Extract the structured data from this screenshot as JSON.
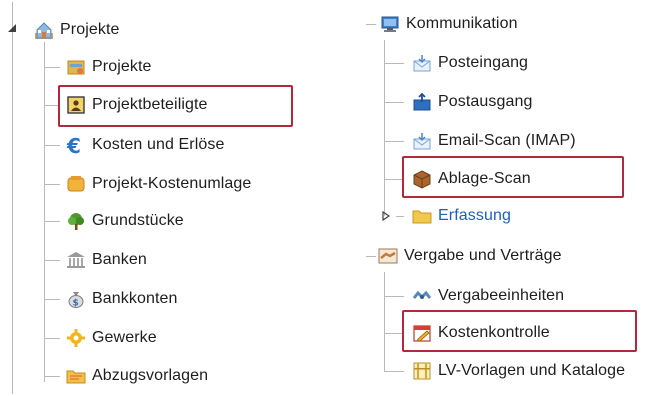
{
  "left_tree": {
    "root": {
      "label": "Projekte",
      "icon": "projects-house-icon",
      "expanded": true
    },
    "children": [
      {
        "label": "Projekte",
        "icon": "project-folder-icon"
      },
      {
        "label": "Projektbeteiligte",
        "icon": "contact-card-icon",
        "highlighted": true
      },
      {
        "label": "Kosten und Erlöse",
        "icon": "euro-icon"
      },
      {
        "label": "Projekt-Kostenumlage",
        "icon": "cost-allocation-icon"
      },
      {
        "label": "Grundstücke",
        "icon": "tree-icon"
      },
      {
        "label": "Banken",
        "icon": "bank-icon"
      },
      {
        "label": "Bankkonten",
        "icon": "money-bag-icon"
      },
      {
        "label": "Gewerke",
        "icon": "gear-icon"
      },
      {
        "label": "Abzugsvorlagen",
        "icon": "folder-template-icon"
      }
    ]
  },
  "right_tree": {
    "kommunikation": {
      "label": "Kommunikation",
      "icon": "network-computer-icon",
      "children": [
        {
          "label": "Posteingang",
          "icon": "inbox-icon"
        },
        {
          "label": "Postausgang",
          "icon": "outbox-icon"
        },
        {
          "label": "Email-Scan (IMAP)",
          "icon": "email-scan-icon"
        },
        {
          "label": "Ablage-Scan",
          "icon": "archive-box-icon",
          "highlighted": true
        },
        {
          "label": "Erfassung",
          "icon": "folder-icon",
          "collapsed": true
        }
      ]
    },
    "vergabe": {
      "label": "Vergabe und Verträge",
      "icon": "handshake-icon",
      "children": [
        {
          "label": "Vergabeeinheiten",
          "icon": "handshake-small-icon"
        },
        {
          "label": "Kostenkontrolle",
          "icon": "calendar-edit-icon",
          "highlighted": true
        },
        {
          "label": "LV-Vorlagen und Kataloge",
          "icon": "catalog-icon"
        }
      ]
    }
  },
  "colors": {
    "highlight_border": "#b3283a",
    "tree_line": "#b9b9b9",
    "link_text": "#1f5fb8"
  }
}
